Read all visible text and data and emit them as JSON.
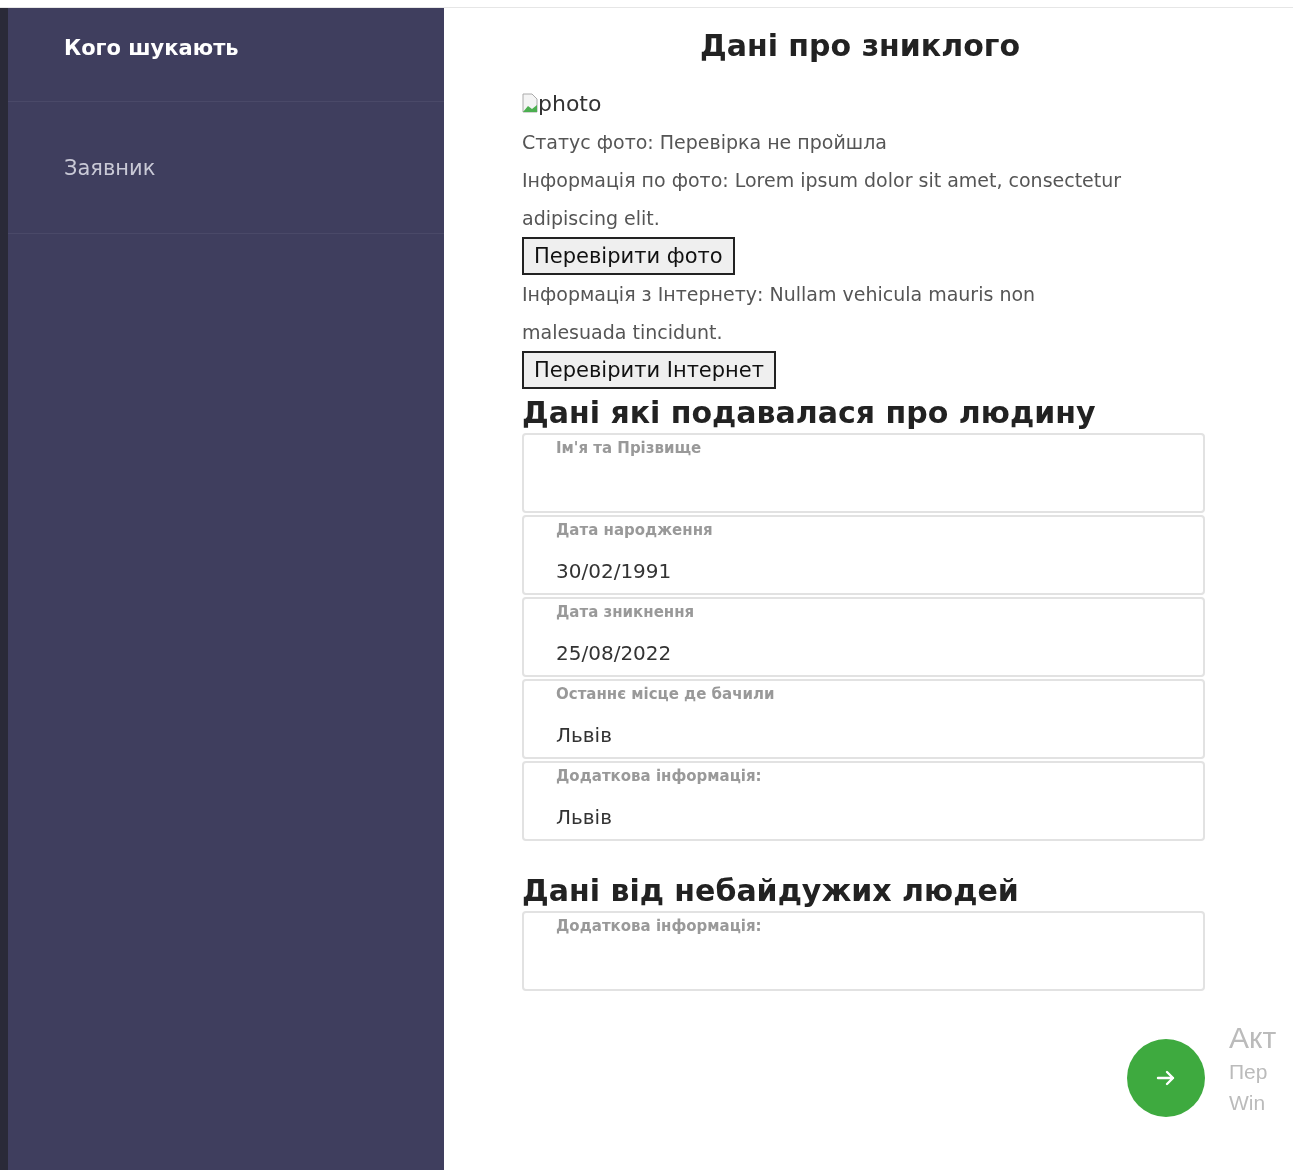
{
  "sidebar": {
    "items": [
      {
        "label": "Кого шукають",
        "selected": true
      },
      {
        "label": "Заявник",
        "selected": false
      }
    ]
  },
  "main": {
    "title": "Дані про зниклого",
    "photo": {
      "alt": "photo"
    },
    "photo_status": "Статус фото: Перевірка не пройшла",
    "photo_info": "Інформація по фото: Lorem ipsum dolor sit amet, consectetur adipiscing elit.",
    "check_photo_button": "Перевірити фото",
    "internet_info": "Інформація з Інтернету: Nullam vehicula mauris non malesuada tincidunt.",
    "check_internet_button": "Перевірити Інтернет",
    "sections": [
      {
        "title": "Дані які подавалася про людину",
        "fields": [
          {
            "label": "Ім'я та Прізвище"
          },
          {
            "label": "Дата народження",
            "value": "30/02/1991"
          },
          {
            "label": "Дата зникнення",
            "value": "25/08/2022"
          },
          {
            "label": "Останнє місце де бачили",
            "value": "Львів"
          },
          {
            "label": "Додаткова інформація:",
            "value": "Львів"
          }
        ]
      },
      {
        "title": "Дані від небайдужих людей",
        "fields": [
          {
            "label": "Додаткова інформація:"
          }
        ]
      }
    ]
  },
  "activation_notice": [
    "Акт",
    "Пер",
    "Win"
  ]
}
